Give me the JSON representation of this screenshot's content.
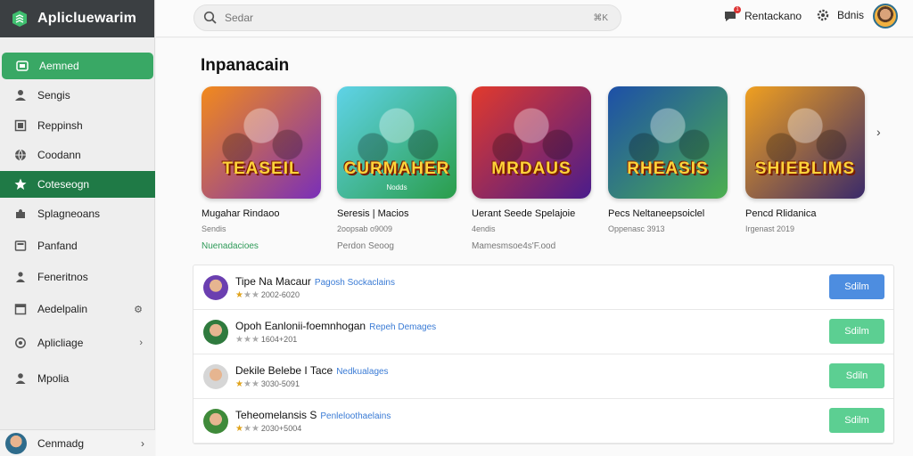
{
  "app": {
    "title": "Aplicluewarim"
  },
  "search": {
    "placeholder": "Sedar",
    "shortcut": "⌘K"
  },
  "header": {
    "notification_label": "Rentackano",
    "notification_count": "1",
    "settings_label": "Bdnis"
  },
  "sidebar": {
    "items": [
      {
        "label": "Aemned",
        "icon": "app-icon",
        "state": "active-light"
      },
      {
        "label": "Sengis",
        "icon": "user-icon"
      },
      {
        "label": "Reppinsh",
        "icon": "box-icon"
      },
      {
        "label": "Coodann",
        "icon": "globe-icon"
      },
      {
        "label": "Coteseogn",
        "icon": "star-icon",
        "state": "active-dark"
      },
      {
        "label": "Splagneoans",
        "icon": "puzzle-icon"
      },
      {
        "label": "Panfand",
        "icon": "folder-icon"
      },
      {
        "label": "Feneritnos",
        "icon": "users-icon"
      },
      {
        "label": "Aedelpalin",
        "icon": "calendar-icon",
        "trail": "⚙"
      },
      {
        "label": "Aplicliage",
        "icon": "settings-icon",
        "trail": "›"
      },
      {
        "label": "Mpolia",
        "icon": "person-icon"
      }
    ],
    "footer": {
      "label": "Cenmadg"
    }
  },
  "main": {
    "section_title": "Inpanacain",
    "featured": [
      {
        "name": "Mugahar Rindaoo",
        "meta": "Sendis",
        "tag": "Nuenadacioes",
        "art_title": "TEASEIL",
        "art_sub": "",
        "tag_color": "green",
        "colors": [
          "#f28a1c",
          "#7a2fb8"
        ]
      },
      {
        "name": "Seresis | Macios",
        "meta": "2oopsab o9009",
        "tag": "Perdon Seoog",
        "art_title": "CURMAHER",
        "art_sub": "Nodds",
        "tag_color": "gray",
        "colors": [
          "#5fd3e8",
          "#2a9d4a"
        ]
      },
      {
        "name": "Uerant Seede Spelajoie",
        "meta": "4endis",
        "tag": "Mamesmsoe4s'F.ood",
        "art_title": "MRDAUS",
        "art_sub": "",
        "tag_color": "gray",
        "colors": [
          "#e23a2c",
          "#4a1c8c"
        ]
      },
      {
        "name": "Pecs Neltaneepsoiclel",
        "meta": "Oppenasc 3913",
        "tag": "",
        "art_title": "RHEASIS",
        "art_sub": "",
        "tag_color": "gray",
        "colors": [
          "#1d4fa8",
          "#4caf50"
        ]
      },
      {
        "name": "Pencd Rlidanica",
        "meta": "Irgenast 2019",
        "tag": "",
        "art_title": "SHIEBLIMS",
        "art_sub": "",
        "tag_color": "gray",
        "colors": [
          "#f0a020",
          "#3a2a6a"
        ]
      }
    ],
    "apps": [
      {
        "title": "Tipe Na Macaur",
        "link": "Pagosh Sockaclains",
        "rating": "2002-6020",
        "stars": 1,
        "button": "Sdilm",
        "button_style": "blue",
        "avatar_color": "#6b3fb0"
      },
      {
        "title": "Opoh Eanlonii-foemnhogan",
        "link": "Repeh Demages",
        "rating": "1604+201",
        "stars": 0,
        "button": "Sdilm",
        "button_style": "green",
        "avatar_color": "#2f7a3e"
      },
      {
        "title": "Dekile Belebe I Tace",
        "link": "Nedkualages",
        "rating": "3030-5091",
        "stars": 1,
        "button": "Sdiln",
        "button_style": "green",
        "avatar_color": "#d6d6d6"
      },
      {
        "title": "Teheomelansis S",
        "link": "Penleloothaelains",
        "rating": "2030+5004",
        "stars": 1,
        "button": "Sdilm",
        "button_style": "green",
        "avatar_color": "#3f8a3a"
      }
    ]
  }
}
